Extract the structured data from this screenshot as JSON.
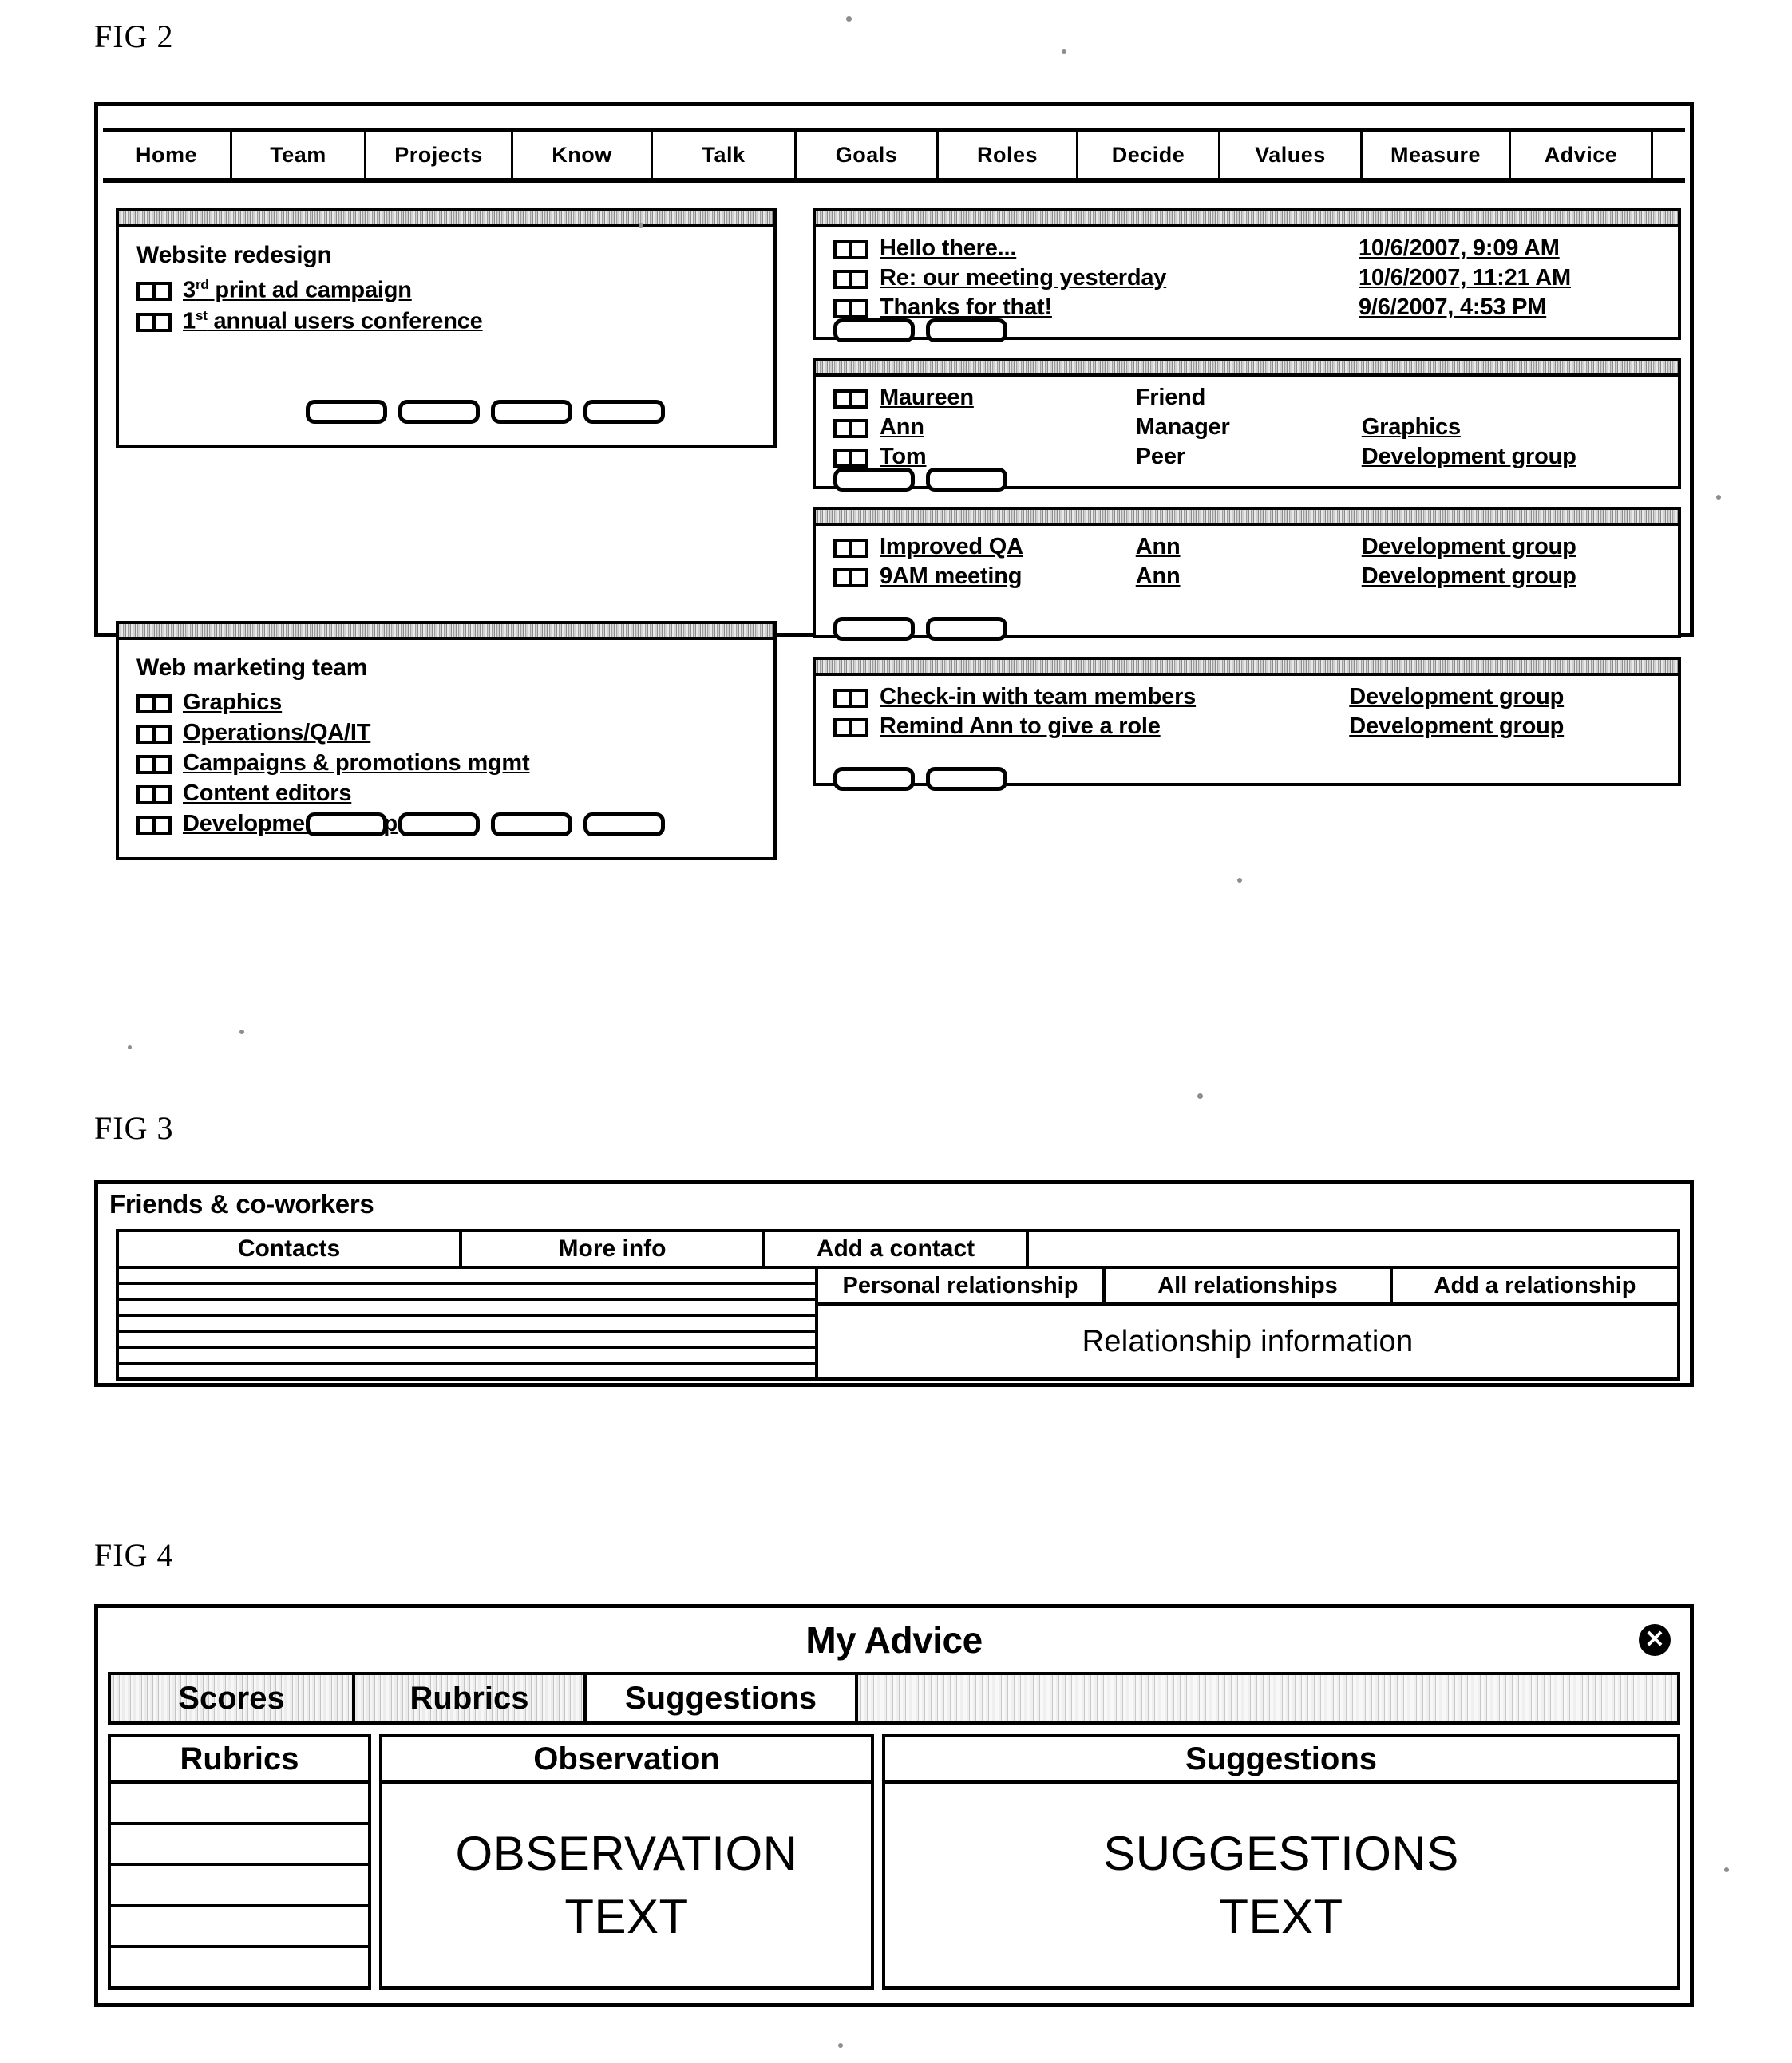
{
  "figures": {
    "fig2_label": "FIG 2",
    "fig3_label": "FIG 3",
    "fig4_label": "FIG 4"
  },
  "fig2": {
    "tabs": [
      {
        "label": "Home"
      },
      {
        "label": "Team"
      },
      {
        "label": "Projects"
      },
      {
        "label": "Know"
      },
      {
        "label": "Talk"
      },
      {
        "label": "Goals"
      },
      {
        "label": "Roles"
      },
      {
        "label": "Decide"
      },
      {
        "label": "Values"
      },
      {
        "label": "Measure"
      },
      {
        "label": "Advice"
      }
    ],
    "projects_panel": {
      "heading": "Website redesign",
      "items": [
        {
          "prefix": "3",
          "sup": "rd",
          "label": " print ad campaign"
        },
        {
          "prefix": "1",
          "sup": "st",
          "label": " annual users conference"
        }
      ],
      "buttons": [
        "",
        "",
        "",
        ""
      ]
    },
    "team_panel": {
      "heading": "Web marketing team",
      "items": [
        {
          "label": "Graphics"
        },
        {
          "label": "Operations/QA/IT"
        },
        {
          "label": "Campaigns & promotions mgmt"
        },
        {
          "label": "Content editors"
        },
        {
          "label": "Development group"
        }
      ],
      "buttons": [
        "",
        "",
        "",
        ""
      ]
    },
    "messages_panel": {
      "rows": [
        {
          "subject": "Hello there...",
          "timestamp": "10/6/2007,  9:09  AM"
        },
        {
          "subject": "Re: our meeting yesterday",
          "timestamp": "10/6/2007, 11:21 AM"
        },
        {
          "subject": "Thanks for that!",
          "timestamp": "9/6/2007,    4:53  PM"
        }
      ],
      "buttons": [
        "",
        ""
      ]
    },
    "contacts_panel": {
      "rows": [
        {
          "name": "Maureen",
          "relationship": "Friend",
          "group": ""
        },
        {
          "name": "Ann",
          "relationship": "Manager",
          "group": "Graphics"
        },
        {
          "name": "Tom",
          "relationship": "Peer",
          "group": "Development group"
        }
      ],
      "buttons": [
        "",
        ""
      ]
    },
    "goals_panel": {
      "rows": [
        {
          "title": "Improved QA",
          "owner": "Ann",
          "group": "Development group"
        },
        {
          "title": "9AM meeting",
          "owner": "Ann",
          "group": "Development group"
        }
      ],
      "buttons": [
        "",
        ""
      ]
    },
    "tasks_panel": {
      "rows": [
        {
          "title": "Check-in with team members",
          "group": "Development group"
        },
        {
          "title": "Remind Ann to give a role",
          "group": "Development group"
        }
      ],
      "buttons": [
        "",
        ""
      ]
    }
  },
  "fig3": {
    "title": "Friends & co-workers",
    "tabs": [
      {
        "label": "Contacts"
      },
      {
        "label": "More info"
      },
      {
        "label": "Add a contact"
      },
      {
        "label": ""
      }
    ],
    "contact_rows": [
      "",
      "",
      "",
      "",
      "",
      "",
      ""
    ],
    "sub_tabs": [
      {
        "label": "Personal relationship"
      },
      {
        "label": "All relationships"
      },
      {
        "label": "Add a relationship"
      }
    ],
    "relationship_info": "Relationship information"
  },
  "fig4": {
    "title": "My Advice",
    "close_icon": "✕",
    "tabs": [
      {
        "label": "Scores",
        "active": false
      },
      {
        "label": "Rubrics",
        "active": false
      },
      {
        "label": "Suggestions",
        "active": true
      }
    ],
    "columns": {
      "rubrics_header": "Rubrics",
      "observation_header": "Observation",
      "suggestions_header": "Suggestions"
    },
    "rubric_rows": [
      "",
      "",
      "",
      "",
      ""
    ],
    "observation_text_line1": "OBSERVATION",
    "observation_text_line2": "TEXT",
    "suggestions_text_line1": "SUGGESTIONS",
    "suggestions_text_line2": "TEXT"
  }
}
